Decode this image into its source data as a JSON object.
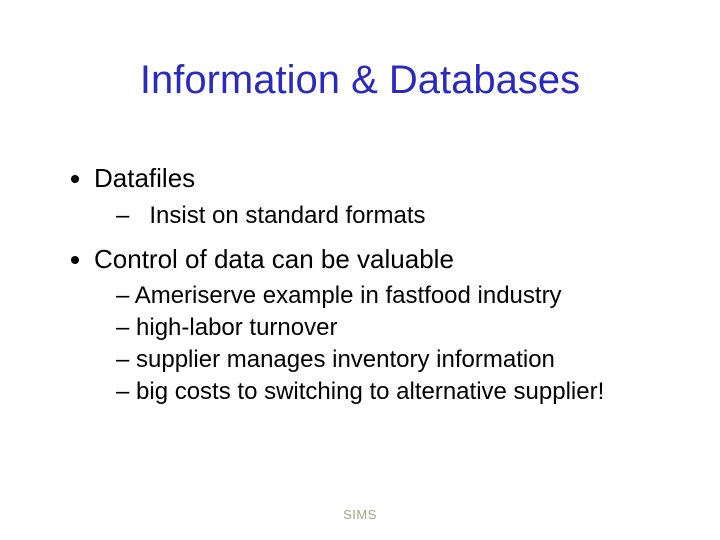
{
  "title": "Information & Databases",
  "bullets": {
    "item1": {
      "label": "Datafiles",
      "sub": [
        "Insist on standard formats"
      ]
    },
    "item2": {
      "label": "Control of data can be valuable",
      "sub": [
        "Ameriserve example in fastfood industry",
        "high-labor turnover",
        "supplier manages inventory information",
        "big costs to switching to alternative supplier!"
      ]
    }
  },
  "footer": "SIMS"
}
